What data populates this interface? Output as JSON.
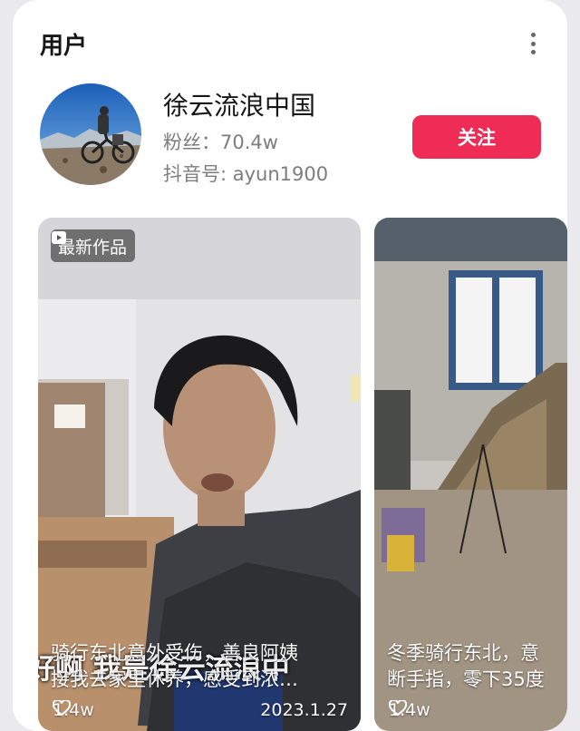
{
  "section": {
    "title": "用户"
  },
  "user": {
    "name": "徐云流浪中国",
    "fans": "粉丝：70.4w",
    "douyin_id": "抖音号: ayun1900",
    "follow_label": "关注"
  },
  "videos": [
    {
      "badge": "最新作品",
      "caption_line1": "骑行东北意外受伤，善良阿姨",
      "caption_line2": "接我去家里休养，感受到浓…",
      "subtitle": "好啊 我是徐云流浪中",
      "likes": "1.4w",
      "date": "2023.1.27"
    },
    {
      "caption_line1": "冬季骑行东北，意",
      "caption_line2": "断手指，零下35度",
      "likes": "1.4w"
    }
  ],
  "colors": {
    "accent": "#ee2c55",
    "secondary_text": "#7d7d7d"
  },
  "icons": {
    "more": "more-vertical-icon",
    "badge": "video-play-icon",
    "likes": "heart-outline-icon"
  }
}
